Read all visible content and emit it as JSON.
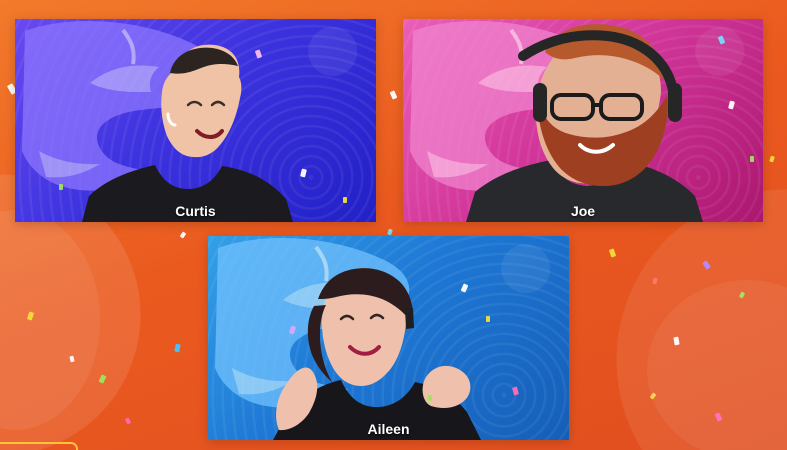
{
  "participants": [
    {
      "name": "Curtis"
    },
    {
      "name": "Joe"
    },
    {
      "name": "Aileen"
    }
  ]
}
